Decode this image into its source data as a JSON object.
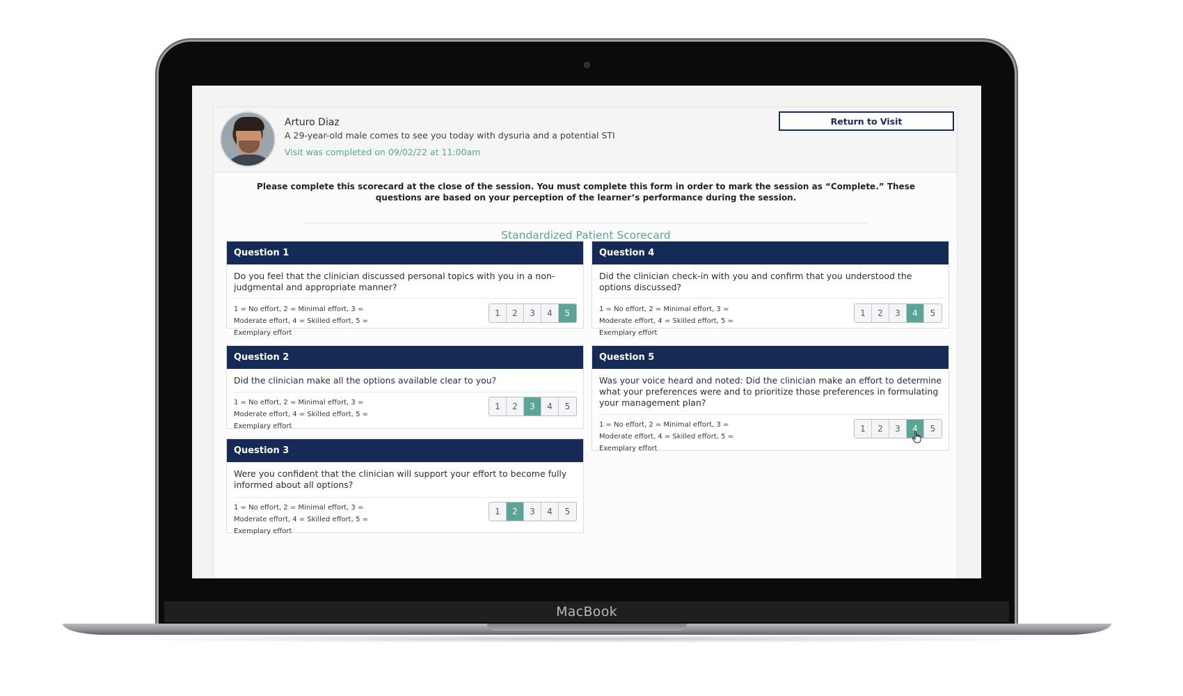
{
  "device": {
    "brand": "MacBook"
  },
  "patient": {
    "name": "Arturo Diaz",
    "description": "A 29-year-old male comes to see you today with dysuria and a potential STI",
    "visit_status": "Visit was completed on 09/02/22 at 11:00am"
  },
  "header": {
    "return_button": "Return to Visit"
  },
  "instructions": "Please complete this scorecard at the close of the session. You must complete this form in order to mark the session as “Complete.” These questions are based on your perception of the learner’s performance during the session.",
  "scorecard_title": "Standardized Patient Scorecard",
  "scale_legend": "1 = No effort, 2 = Minimal effort, 3 = Moderate effort, 4 = Skilled effort, 5 = Exemplary effort",
  "questions": [
    {
      "title": "Question 1",
      "text": "Do you feel that the clinician discussed personal topics with you in a non-judgmental and appropriate manner?",
      "options": [
        "1",
        "2",
        "3",
        "4",
        "5"
      ],
      "selected": "5"
    },
    {
      "title": "Question 2",
      "text": "Did the clinician make all the options available clear to you?",
      "options": [
        "1",
        "2",
        "3",
        "4",
        "5"
      ],
      "selected": "3"
    },
    {
      "title": "Question 3",
      "text": "Were you confident that the clinician will support your effort to become fully informed about all options?",
      "options": [
        "1",
        "2",
        "3",
        "4",
        "5"
      ],
      "selected": "2"
    },
    {
      "title": "Question 4",
      "text": "Did the clinician check-in with you and confirm that you understood the options discussed?",
      "options": [
        "1",
        "2",
        "3",
        "4",
        "5"
      ],
      "selected": "4"
    },
    {
      "title": "Question 5",
      "text": "Was your voice heard and noted: Did the clinician make an effort to determine what your preferences were and to prioritize those preferences in formulating your management plan?",
      "options": [
        "1",
        "2",
        "3",
        "4",
        "5"
      ],
      "selected": "4"
    }
  ],
  "colors": {
    "navy": "#152a55",
    "accent": "#5aa596"
  }
}
